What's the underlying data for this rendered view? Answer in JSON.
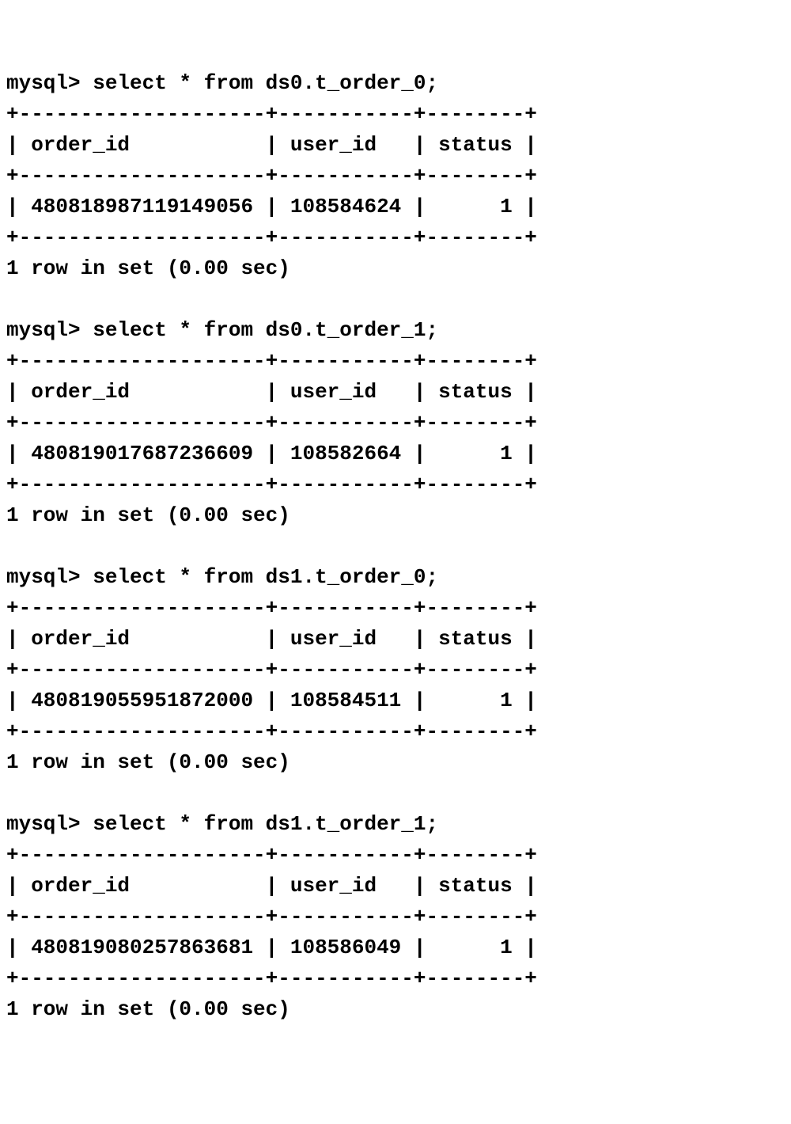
{
  "queries": [
    {
      "prompt": "mysql> ",
      "sql": "select * from ds0.t_order_0;",
      "columns": [
        "order_id",
        "user_id",
        "status"
      ],
      "rows": [
        {
          "order_id": "480818987119149056",
          "user_id": "108584624",
          "status": "1"
        }
      ],
      "footer": "1 row in set (0.00 sec)"
    },
    {
      "prompt": "mysql> ",
      "sql": "select * from ds0.t_order_1;",
      "columns": [
        "order_id",
        "user_id",
        "status"
      ],
      "rows": [
        {
          "order_id": "480819017687236609",
          "user_id": "108582664",
          "status": "1"
        }
      ],
      "footer": "1 row in set (0.00 sec)"
    },
    {
      "prompt": "mysql> ",
      "sql": "select * from ds1.t_order_0;",
      "columns": [
        "order_id",
        "user_id",
        "status"
      ],
      "rows": [
        {
          "order_id": "480819055951872000",
          "user_id": "108584511",
          "status": "1"
        }
      ],
      "footer": "1 row in set (0.00 sec)"
    },
    {
      "prompt": "mysql> ",
      "sql": "select * from ds1.t_order_1;",
      "columns": [
        "order_id",
        "user_id",
        "status"
      ],
      "rows": [
        {
          "order_id": "480819080257863681",
          "user_id": "108586049",
          "status": "1"
        }
      ],
      "footer": "1 row in set (0.00 sec)"
    }
  ],
  "widths": {
    "order_id": 20,
    "user_id": 11,
    "status": 8
  }
}
